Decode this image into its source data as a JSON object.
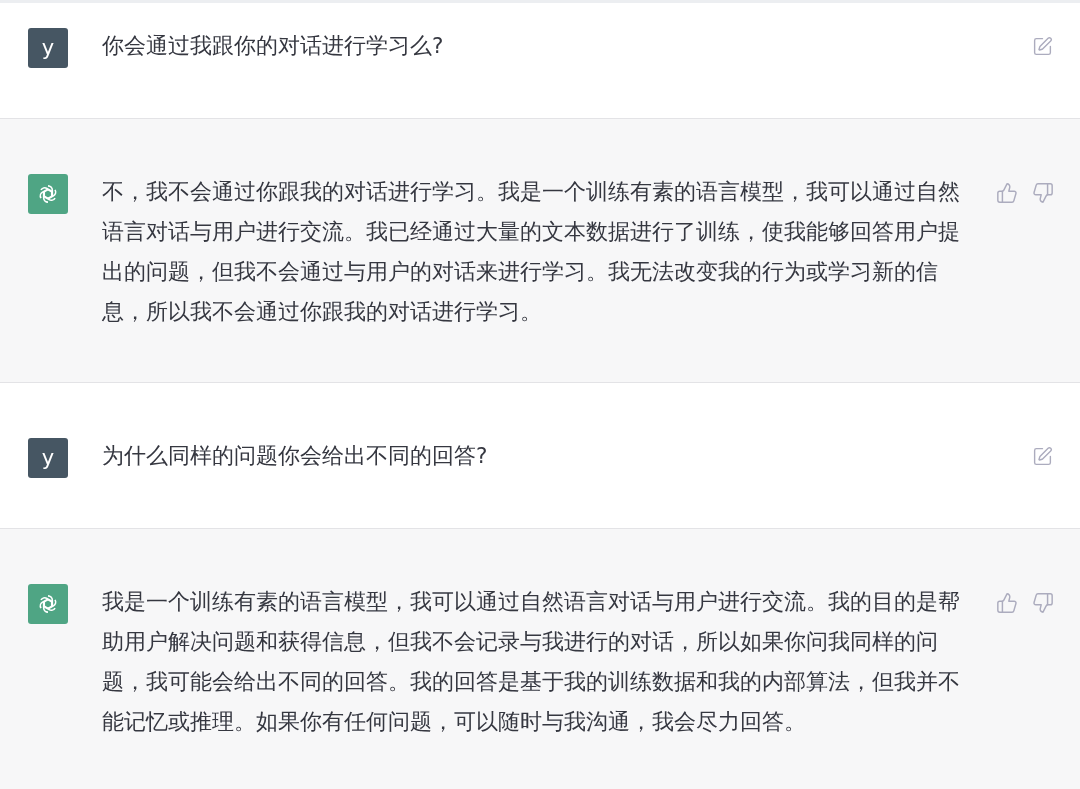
{
  "messages": [
    {
      "kind": "user",
      "avatar": "y",
      "text": "你会通过我跟你的对话进行学习么?"
    },
    {
      "kind": "assistant",
      "text": "不，我不会通过你跟我的对话进行学习。我是一个训练有素的语言模型，我可以通过自然语言对话与用户进行交流。我已经通过大量的文本数据进行了训练，使我能够回答用户提出的问题，但我不会通过与用户的对话来进行学习。我无法改变我的行为或学习新的信息，所以我不会通过你跟我的对话进行学习。"
    },
    {
      "kind": "user",
      "avatar": "y",
      "text": "为什么同样的问题你会给出不同的回答?"
    },
    {
      "kind": "assistant",
      "text": "我是一个训练有素的语言模型，我可以通过自然语言对话与用户进行交流。我的目的是帮助用户解决问题和获得信息，但我不会记录与我进行的对话，所以如果你问我同样的问题，我可能会给出不同的回答。我的回答是基于我的训练数据和我的内部算法，但我并不能记忆或推理。如果你有任何问题，可以随时与我沟通，我会尽力回答。"
    }
  ]
}
